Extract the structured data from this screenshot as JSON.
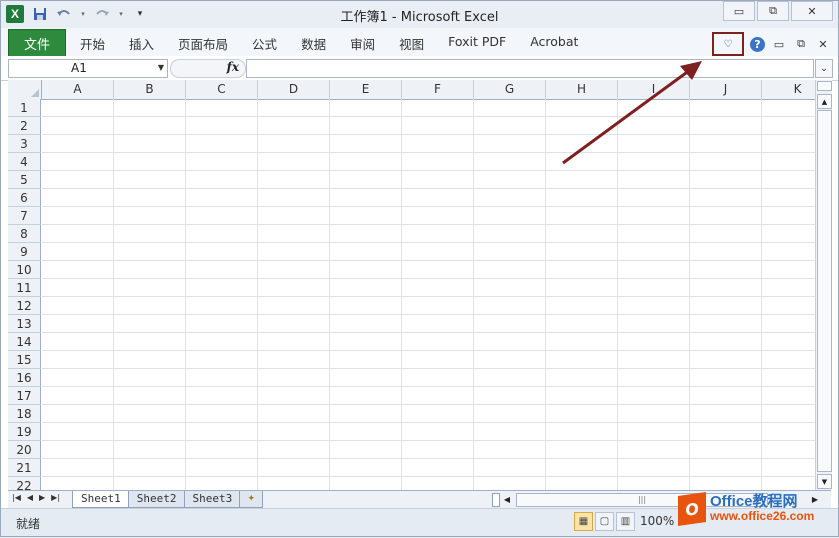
{
  "window": {
    "title": "工作簿1 - Microsoft Excel",
    "minimize": "▭",
    "restore": "⧉",
    "close": "✕"
  },
  "qat": {
    "app_icon": "X",
    "save_icon": "save-icon",
    "undo_icon": "undo-icon",
    "redo_icon": "redo-icon"
  },
  "ribbon": {
    "file_tab": "文件",
    "tabs": [
      "开始",
      "插入",
      "页面布局",
      "公式",
      "数据",
      "审阅",
      "视图",
      "Foxit PDF",
      "Acrobat"
    ],
    "minimize_ribbon_glyph": "♡",
    "help_glyph": "?"
  },
  "formula_bar": {
    "name_box": "A1",
    "fx": "fx",
    "formula": ""
  },
  "grid": {
    "columns": [
      "A",
      "B",
      "C",
      "D",
      "E",
      "F",
      "G",
      "H",
      "I",
      "J",
      "K"
    ],
    "rows": [
      "1",
      "2",
      "3",
      "4",
      "5",
      "6",
      "7",
      "8",
      "9",
      "10",
      "11",
      "12",
      "13",
      "14",
      "15",
      "16",
      "17",
      "18",
      "19",
      "20",
      "21",
      "22"
    ]
  },
  "sheets": {
    "tabs": [
      "Sheet1",
      "Sheet2",
      "Sheet3"
    ],
    "active": "Sheet1"
  },
  "status": {
    "ready": "就绪",
    "zoom": "100%"
  },
  "watermark": {
    "title": "Office教程网",
    "url": "www.office26.com",
    "logo": "O"
  },
  "colors": {
    "file_tab": "#2e8b3e",
    "annotation": "#7f1f1f",
    "watermark_orange": "#e8530e",
    "watermark_blue": "#2a6fbf"
  }
}
